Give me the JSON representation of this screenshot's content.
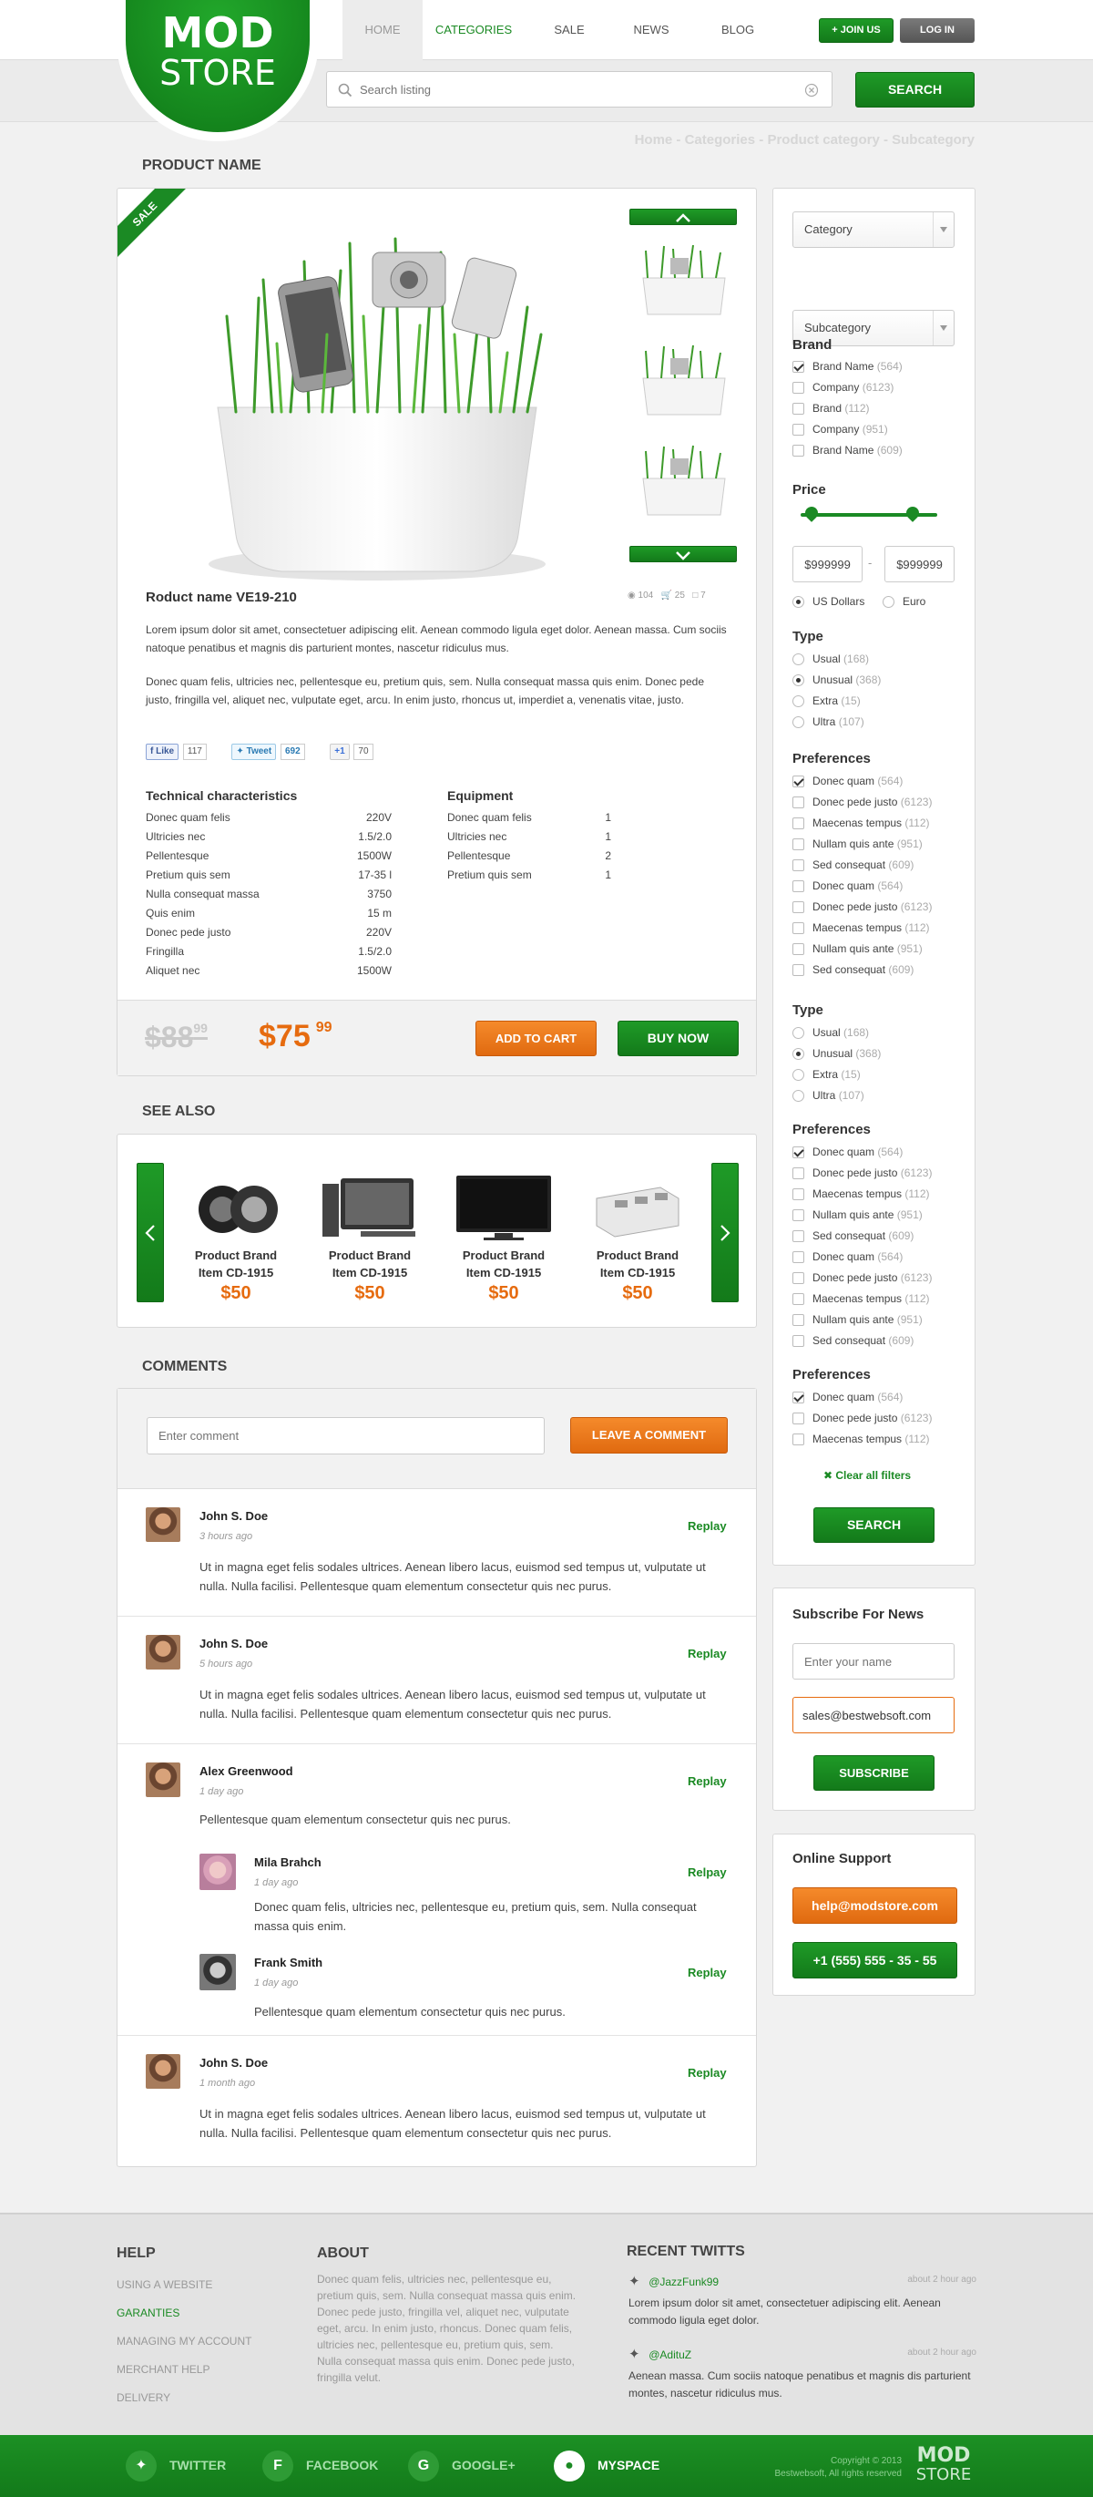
{
  "logo": {
    "line1": "MOD",
    "line2": "STORE"
  },
  "nav": {
    "items": [
      "HOME",
      "CATEGORIES",
      "SALE",
      "NEWS",
      "BLOG"
    ],
    "join": "+ JOIN US",
    "login": "LOG IN"
  },
  "search": {
    "placeholder": "Search listing",
    "button": "SEARCH"
  },
  "breadcrumb": "Home - Categories - Product category - Subcategory",
  "product": {
    "section_title": "PRODUCT NAME",
    "sale_badge": "SALE",
    "name": "Roduct name VE19-210",
    "stats": {
      "views": "104",
      "cart": "25",
      "comments": "7"
    },
    "desc1": "Lorem ipsum dolor sit amet, consectetuer adipiscing elit. Aenean commodo ligula eget dolor. Aenean massa. Cum sociis natoque penatibus et magnis dis parturient montes, nascetur ridiculus mus.",
    "desc2": "Donec quam felis, ultricies nec, pellentesque eu, pretium quis, sem. Nulla consequat massa quis enim. Donec pede justo, fringilla vel, aliquet nec, vulputate eget, arcu. In enim justo, rhoncus ut, imperdiet a, venenatis vitae, justo.",
    "share": {
      "like": "Like",
      "like_count": "117",
      "tweet": "Tweet",
      "tweet_count": "692",
      "plus": "+1",
      "plus_count": "70"
    },
    "tech_title": "Technical characteristics",
    "tech": [
      [
        "Donec quam felis",
        "220V"
      ],
      [
        "Ultricies nec",
        "1.5/2.0"
      ],
      [
        "Pellentesque",
        "1500W"
      ],
      [
        "Pretium quis sem",
        "17-35 l"
      ],
      [
        "Nulla consequat massa",
        "3750"
      ],
      [
        "Quis enim",
        "15 m"
      ],
      [
        "Donec pede justo",
        "220V"
      ],
      [
        "Fringilla",
        "1.5/2.0"
      ],
      [
        "Aliquet nec",
        "1500W"
      ]
    ],
    "equip_title": "Equipment",
    "equip": [
      [
        "Donec quam felis",
        "1"
      ],
      [
        "Ultricies nec",
        "1"
      ],
      [
        "Pellentesque",
        "2"
      ],
      [
        "Pretium quis sem",
        "1"
      ]
    ],
    "old_price": "$88",
    "old_cents": "99",
    "price": "$75",
    "cents": "99",
    "add_to_cart": "ADD TO CART",
    "buy_now": "BUY NOW"
  },
  "see_also": {
    "title": "SEE ALSO",
    "items": [
      {
        "name1": "Product Brand",
        "name2": "Item CD-1915",
        "price": "$50"
      },
      {
        "name1": "Product Brand",
        "name2": "Item CD-1915",
        "price": "$50"
      },
      {
        "name1": "Product Brand",
        "name2": "Item CD-1915",
        "price": "$50"
      },
      {
        "name1": "Product Brand",
        "name2": "Item CD-1915",
        "price": "$50"
      }
    ]
  },
  "comments": {
    "title": "COMMENTS",
    "placeholder": "Enter comment",
    "button": "LEAVE A COMMENT",
    "reply": "Replay",
    "relpy_alt": "Relpay",
    "list": [
      {
        "name": "John S. Doe",
        "time": "3 hours ago",
        "text": "Ut in magna eget felis sodales ultrices. Aenean libero lacus, euismod sed tempus ut, vulputate ut nulla. Nulla facilisi. Pellentesque quam elementum consectetur quis nec purus."
      },
      {
        "name": "John S. Doe",
        "time": "5 hours ago",
        "text": "Ut in magna eget felis sodales ultrices. Aenean libero lacus, euismod sed tempus ut, vulputate ut nulla. Nulla facilisi. Pellentesque quam elementum consectetur quis nec purus."
      },
      {
        "name": "Alex Greenwood",
        "time": "1 day ago",
        "text": "Pellentesque quam elementum consectetur quis nec purus."
      },
      {
        "name": "Mila Brahch",
        "time": "1 day ago",
        "text": "Donec quam felis, ultricies nec, pellentesque eu, pretium quis, sem. Nulla consequat massa quis enim."
      },
      {
        "name": "Frank Smith",
        "time": "1 day ago",
        "text": "Pellentesque quam elementum consectetur quis nec purus."
      },
      {
        "name": "John S. Doe",
        "time": "1 month ago",
        "text": "Ut in magna eget felis sodales ultrices. Aenean libero lacus, euismod sed tempus ut, vulputate ut nulla. Nulla facilisi. Pellentesque quam elementum consectetur quis nec purus."
      }
    ]
  },
  "filters": {
    "category": "Category",
    "subcategory": "Subcategory",
    "brand_title": "Brand",
    "brands": [
      {
        "label": "Brand Name",
        "count": "(564)",
        "on": true
      },
      {
        "label": "Company",
        "count": "(6123)",
        "on": false
      },
      {
        "label": "Brand",
        "count": "(112)",
        "on": false
      },
      {
        "label": "Company",
        "count": "(951)",
        "on": false
      },
      {
        "label": "Brand Name",
        "count": "(609)",
        "on": false
      }
    ],
    "price_title": "Price",
    "price_min": "$999999",
    "price_max": "$999999",
    "cur1": "US Dollars",
    "cur2": "Euro",
    "type_title": "Type",
    "types": [
      {
        "label": "Usual",
        "count": "(168)",
        "on": false
      },
      {
        "label": "Unusual",
        "count": "(368)",
        "on": true
      },
      {
        "label": "Extra",
        "count": "(15)",
        "on": false
      },
      {
        "label": "Ultra",
        "count": "(107)",
        "on": false
      }
    ],
    "pref_title": "Preferences",
    "prefs": [
      {
        "label": "Donec quam",
        "count": "(564)",
        "on": true
      },
      {
        "label": "Donec pede justo",
        "count": "(6123)",
        "on": false
      },
      {
        "label": "Maecenas tempus",
        "count": "(112)",
        "on": false
      },
      {
        "label": "Nullam quis ante",
        "count": "(951)",
        "on": false
      },
      {
        "label": "Sed consequat",
        "count": "(609)",
        "on": false
      },
      {
        "label": "Donec quam",
        "count": "(564)",
        "on": false
      },
      {
        "label": "Donec pede justo",
        "count": "(6123)",
        "on": false
      },
      {
        "label": "Maecenas tempus",
        "count": "(112)",
        "on": false
      },
      {
        "label": "Nullam quis ante",
        "count": "(951)",
        "on": false
      },
      {
        "label": "Sed consequat",
        "count": "(609)",
        "on": false
      }
    ],
    "prefs3": [
      {
        "label": "Donec quam",
        "count": "(564)",
        "on": true
      },
      {
        "label": "Donec pede justo",
        "count": "(6123)",
        "on": false
      },
      {
        "label": "Maecenas tempus",
        "count": "(112)",
        "on": false
      }
    ],
    "clear": "Clear all filters",
    "search": "SEARCH"
  },
  "subscribe": {
    "title": "Subscribe For News",
    "name_placeholder": "Enter your name",
    "email": "sales@bestwebsoft.com",
    "button": "SUBSCRIBE"
  },
  "support": {
    "title": "Online Support",
    "email": "help@modstore.com",
    "phone": "+1 (555) 555 - 35 - 55"
  },
  "footer": {
    "help_title": "HELP",
    "help_links": [
      "USING A WEBSITE",
      "GARANTIES",
      "MANAGING MY ACCOUNT",
      "MERCHANT HELP",
      "DELIVERY"
    ],
    "about_title": "ABOUT",
    "about_text": "Donec quam felis, ultricies nec, pellentesque eu, pretium quis, sem. Nulla consequat massa quis enim. Donec pede justo, fringilla vel, aliquet nec, vulputate eget, arcu. In enim justo, rhoncus. Donec quam felis, ultricies nec, pellentesque eu, pretium quis, sem. Nulla consequat massa quis enim. Donec pede justo, fringilla velut.",
    "twitts_title": "RECENT TWITTS",
    "twitts": [
      {
        "user": "@JazzFunk99",
        "time": "about 2 hour ago",
        "text": "Lorem ipsum dolor sit amet, consectetuer adipiscing elit. Aenean commodo ligula eget dolor."
      },
      {
        "user": "@AdituZ",
        "time": "about 2 hour ago",
        "text": "Aenean massa. Cum sociis natoque penatibus et magnis dis parturient montes, nascetur ridiculus mus."
      }
    ],
    "social": [
      "TWITTER",
      "FACEBOOK",
      "GOOGLE+",
      "MYSPACE"
    ],
    "copyright1": "Copyright © 2013",
    "copyright2": "Bestwebsoft, All rights reserved",
    "logo1": "MOD",
    "logo2": "STORE"
  },
  "colors": {
    "green": "#1b8a24",
    "orange": "#e66b0f"
  }
}
